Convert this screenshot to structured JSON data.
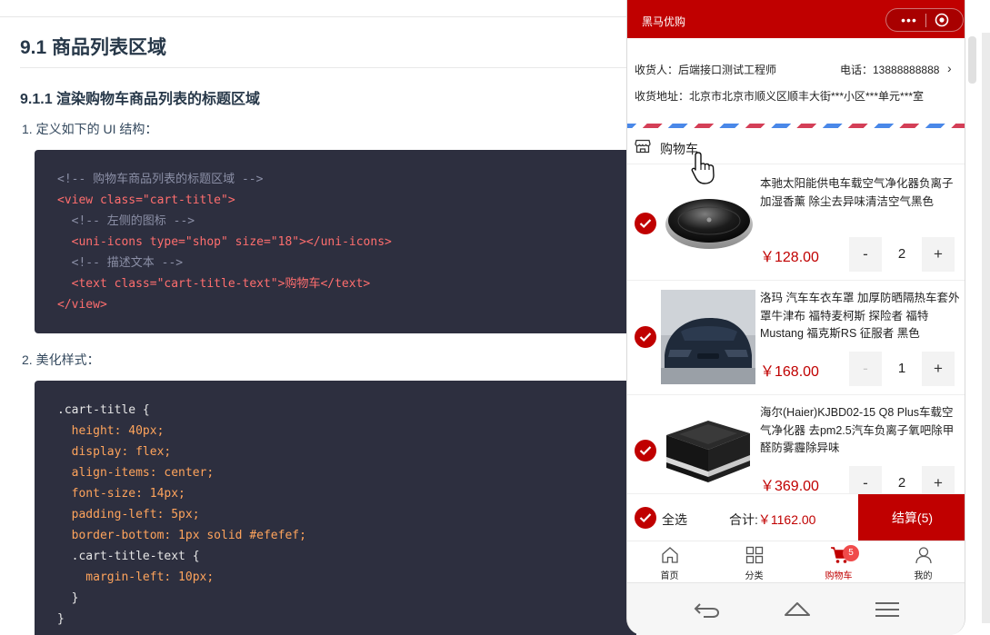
{
  "doc": {
    "h2": "9.1 商品列表区域",
    "h3": "9.1.1 渲染购物车商品列表的标题区域",
    "step1": "1. 定义如下的 UI 结构：",
    "step2": "2. 美化样式：",
    "code1": [
      "<!-- 购物车商品列表的标题区域 -->",
      "<view class=\"cart-title\">",
      "  <!-- 左侧的图标 -->",
      "  <uni-icons type=\"shop\" size=\"18\"></uni-icons>",
      "  <!-- 描述文本 -->",
      "  <text class=\"cart-title-text\">购物车</text>",
      "</view>"
    ],
    "code2": [
      ".cart-title {",
      "  height: 40px;",
      "  display: flex;",
      "  align-items: center;",
      "  font-size: 14px;",
      "  padding-left: 5px;",
      "  border-bottom: 1px solid #efefef;",
      "  .cart-title-text {",
      "    margin-left: 10px;",
      "  }",
      "}"
    ]
  },
  "phone": {
    "nav_title": "黑马优购",
    "capsule_dots": "•••",
    "address": {
      "name_line": "收货人：后端接口测试工程师",
      "phone_line": "电话：13888888888",
      "arrow": "›",
      "detail_line": "收货地址：北京市北京市顺义区顺丰大街***小区***单元***室"
    },
    "cart_title": "购物车",
    "items": [
      {
        "name": "本驰太阳能供电车载空气净化器负离子加湿香薰 除尘去异味清洁空气黑色",
        "price": "￥128.00",
        "count": "2",
        "minus": "-",
        "plus": "+"
      },
      {
        "name": "洛玛 汽车车衣车罩 加厚防晒隔热车套外罩牛津布 福特麦柯斯 探险者 福特Mustang 福克斯RS 征服者 黑色",
        "price": "￥168.00",
        "count": "1",
        "minus": "-",
        "plus": "+"
      },
      {
        "name": "海尔(Haier)KJBD02-15 Q8 Plus车载空气净化器 去pm2.5汽车负离子氧吧除甲醛防雾霾除异味",
        "price": "￥369.00",
        "count": "2",
        "minus": "-",
        "plus": "+"
      }
    ],
    "settle": {
      "select_all": "全选",
      "total_label": "合计:",
      "total_amount": "￥1162.00",
      "button": "结算(5)"
    },
    "tabs": [
      {
        "label": "首页"
      },
      {
        "label": "分类"
      },
      {
        "label": "购物车",
        "badge": "5"
      },
      {
        "label": "我的"
      }
    ],
    "accent": "#c00000"
  }
}
